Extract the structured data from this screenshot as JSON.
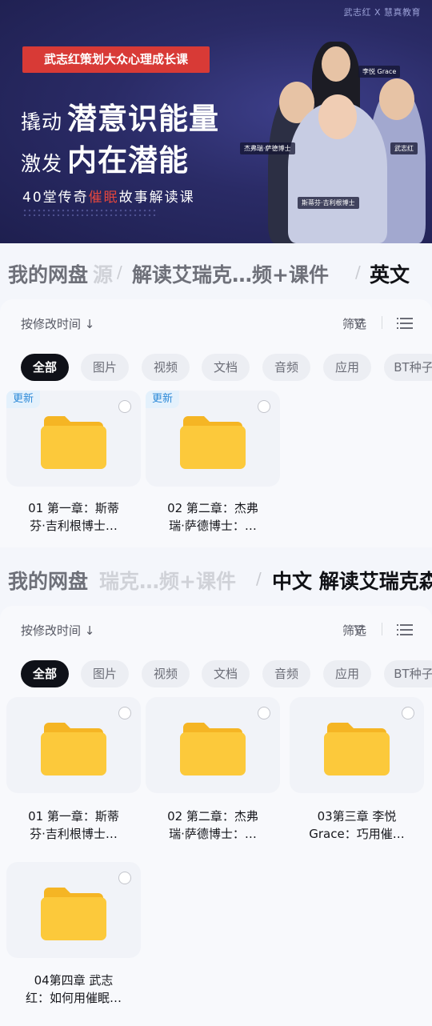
{
  "banner": {
    "brand": "武志红 X 慧真教育",
    "tag": "武志红策划大众心理成长课",
    "headline1_pre": "撬动",
    "headline1": "潜意识能量",
    "headline2_pre": "激发",
    "headline2": "内在潜能",
    "sub_a": "40堂传奇",
    "sub_red": "催眠",
    "sub_b": "故事解读课",
    "names": [
      "李悦 Grace",
      "杰弗瑞·萨德博士",
      "斯蒂芬·吉利根博士",
      "武志红"
    ]
  },
  "section1": {
    "crumb": {
      "root": "我的网盘",
      "faded": "源",
      "parent": "解读艾瑞克…频+课件",
      "current": "英文"
    },
    "sort_label": "按修改时间 ↓",
    "filter_label": "筛选",
    "chips": [
      "全部",
      "图片",
      "视频",
      "文档",
      "音频",
      "应用",
      "BT种子"
    ],
    "files": [
      {
        "badge": "更新",
        "line1": "01 第一章：斯蒂",
        "line2": "芬·吉利根博士…"
      },
      {
        "badge": "更新",
        "line1": "02 第二章：杰弗",
        "line2": "瑞·萨德博士：…"
      }
    ]
  },
  "section2": {
    "crumb": {
      "root": "我的网盘",
      "faded": "瑞克…频+课件",
      "parent": "",
      "current": "中文 解读艾瑞克森"
    },
    "sort_label": "按修改时间 ↓",
    "filter_label": "筛选",
    "chips": [
      "全部",
      "图片",
      "视频",
      "文档",
      "音频",
      "应用",
      "BT种子"
    ],
    "files": [
      {
        "line1": "01 第一章：斯蒂",
        "line2": "芬·吉利根博士…"
      },
      {
        "line1": "02 第二章：杰弗",
        "line2": "瑞·萨德博士：…"
      },
      {
        "line1": "03第三章 李悦",
        "line2": "Grace：巧用催…"
      },
      {
        "line1": "04第四章 武志",
        "line2": "红：如何用催眠…"
      }
    ]
  },
  "colors": {
    "chip_active": "#0f1118",
    "badge_text": "#2d8ad8",
    "folder": "#fbc02d",
    "banner_red": "#d83a36"
  }
}
